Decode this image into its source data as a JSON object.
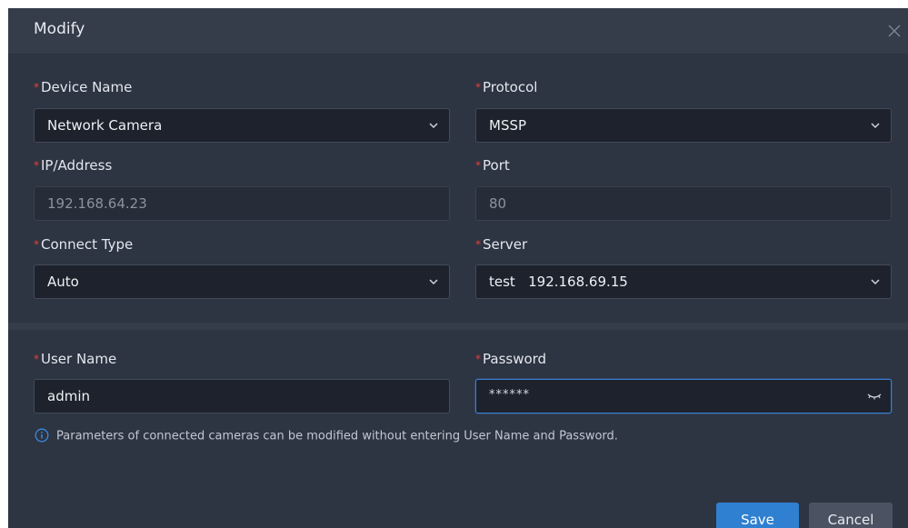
{
  "dialog": {
    "title": "Modify",
    "close_icon": "close-icon"
  },
  "fields": {
    "device_name": {
      "label": "Device Name",
      "value": "Network Camera",
      "required": "*"
    },
    "protocol": {
      "label": "Protocol",
      "value": "MSSP",
      "required": "*"
    },
    "ip_address": {
      "label": "IP/Address",
      "value": "192.168.64.23",
      "required": "*"
    },
    "port": {
      "label": "Port",
      "value": "80",
      "required": "*"
    },
    "connect_type": {
      "label": "Connect Type",
      "value": "Auto",
      "required": "*"
    },
    "server": {
      "label": "Server",
      "value": "test   192.168.69.15",
      "required": "*"
    },
    "user_name": {
      "label": "User Name",
      "value": "admin",
      "required": "*"
    },
    "password": {
      "label": "Password",
      "value": "******",
      "required": "*"
    }
  },
  "hint": {
    "text": "Parameters of connected cameras can be modified without entering User Name and Password.",
    "icon": "info-icon"
  },
  "buttons": {
    "save": "Save",
    "cancel": "Cancel"
  },
  "colors": {
    "accent": "#2f80d0",
    "required": "#e0433a",
    "dialog_bg": "#2d3442",
    "input_bg": "#1d222c"
  }
}
